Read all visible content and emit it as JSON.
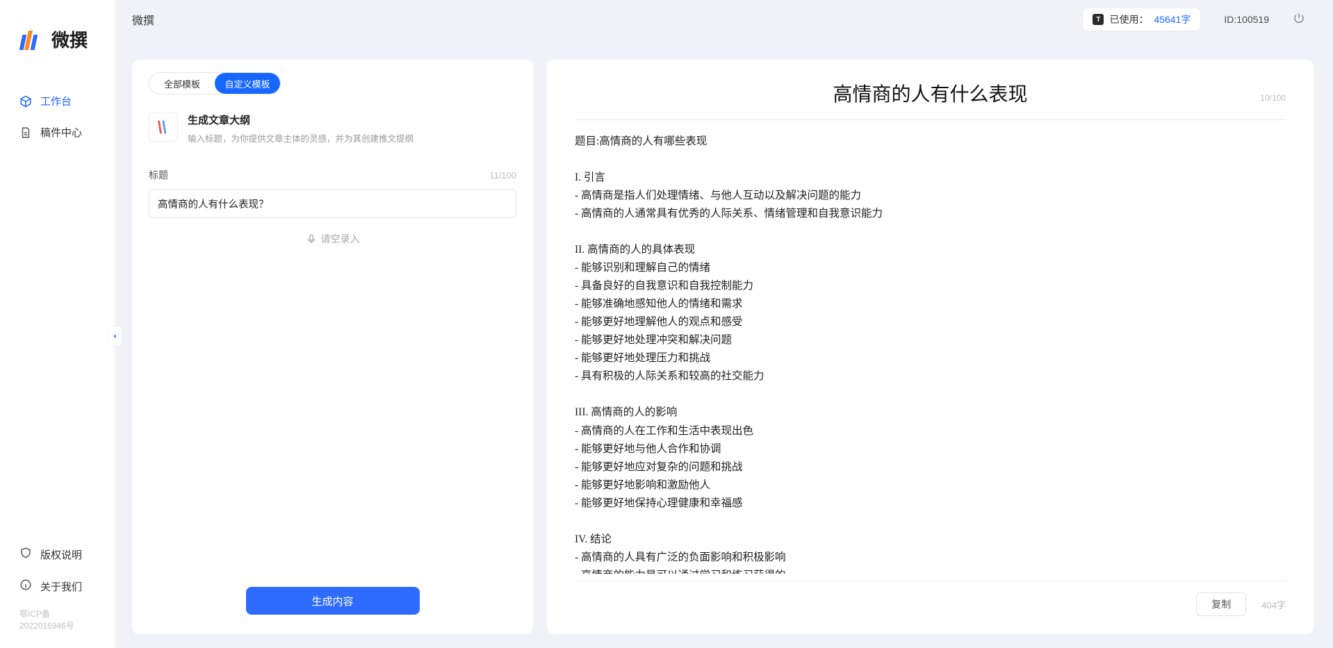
{
  "app": {
    "logo_text": "微撰",
    "title": "微撰"
  },
  "sidebar": {
    "nav": [
      {
        "id": "workbench",
        "label": "工作台",
        "icon": "cube-icon",
        "active": true
      },
      {
        "id": "drafts",
        "label": "稿件中心",
        "icon": "draft-icon",
        "active": false
      }
    ],
    "bottom": [
      {
        "id": "copyright",
        "label": "版权说明",
        "icon": "shield-icon"
      },
      {
        "id": "about",
        "label": "关于我们",
        "icon": "info-icon"
      }
    ],
    "icp": "鄂ICP备2022016946号"
  },
  "topbar": {
    "usage_label": "已使用：",
    "usage_count": "45641字",
    "id_label": "ID:100519"
  },
  "left": {
    "tabs": [
      {
        "id": "all",
        "label": "全部模板",
        "active": false
      },
      {
        "id": "custom",
        "label": "自定义模板",
        "active": true
      }
    ],
    "template": {
      "title": "生成文章大纲",
      "subtitle": "输入标题，为你提供文章主体的灵感，并为其创建推文提纲"
    },
    "field": {
      "label": "标题",
      "count": "11/100",
      "value": "高情商的人有什么表现？"
    },
    "voice_label": "请空录入",
    "generate_label": "生成内容"
  },
  "right": {
    "title": "高情商的人有什么表现",
    "title_count": "10/100",
    "body": "题目:高情商的人有哪些表现\n\nI. 引言\n- 高情商是指人们处理情绪、与他人互动以及解决问题的能力\n- 高情商的人通常具有优秀的人际关系、情绪管理和自我意识能力\n\nII. 高情商的人的具体表现\n- 能够识别和理解自己的情绪\n- 具备良好的自我意识和自我控制能力\n- 能够准确地感知他人的情绪和需求\n- 能够更好地理解他人的观点和感受\n- 能够更好地处理冲突和解决问题\n- 能够更好地处理压力和挑战\n- 具有积极的人际关系和较高的社交能力\n\nIII. 高情商的人的影响\n- 高情商的人在工作和生活中表现出色\n- 能够更好地与他人合作和协调\n- 能够更好地应对复杂的问题和挑战\n- 能够更好地影响和激励他人\n- 能够更好地保持心理健康和幸福感\n\nIV. 结论\n- 高情商的人具有广泛的负面影响和积极影响\n- 高情商的能力是可以通过学习和练习获得的\n- 培养和提高高情商的能力对于个人的职业发展和生活质量至关重要。",
    "copy_label": "复制",
    "char_count": "404字"
  }
}
